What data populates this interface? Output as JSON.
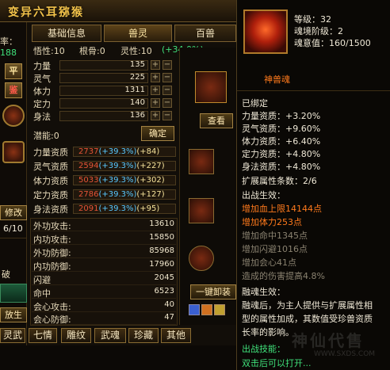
{
  "window": {
    "title": "变异六耳猕猴"
  },
  "left_strip": {
    "frag_top": "率：",
    "frag_green": "188",
    "btn_ping": "平",
    "btn_jian": "鉴",
    "btn_xiugai": "修改",
    "count": "6/10",
    "frag_po": "破",
    "btn_fangsheng": "放生"
  },
  "tabs": [
    {
      "label": "基础信息"
    },
    {
      "label": "兽灵"
    },
    {
      "label": "百兽"
    }
  ],
  "stats_header": {
    "wuxing": "悟性:10",
    "gengu": "根骨:0",
    "lingxing": "灵性:10",
    "lingxing_bonus": "(+34.0%)"
  },
  "base_attrs": [
    {
      "label": "力量",
      "value": "135"
    },
    {
      "label": "灵气",
      "value": "225"
    },
    {
      "label": "体力",
      "value": "1311"
    },
    {
      "label": "定力",
      "value": "140"
    },
    {
      "label": "身法",
      "value": "136"
    }
  ],
  "potential": {
    "label": "潜能:0",
    "confirm": "确定"
  },
  "aptitudes": [
    {
      "label": "力量资质",
      "base": "2737",
      "pct": "(+39.3%)",
      "add": "(+84)"
    },
    {
      "label": "灵气资质",
      "base": "2594",
      "pct": "(+39.3%)",
      "add": "(+227)"
    },
    {
      "label": "体力资质",
      "base": "5033",
      "pct": "(+39.3%)",
      "add": "(+302)"
    },
    {
      "label": "定力资质",
      "base": "2786",
      "pct": "(+39.3%)",
      "add": "(+127)"
    },
    {
      "label": "身法资质",
      "base": "2091",
      "pct": "(+39.3%)",
      "add": "(+95)"
    }
  ],
  "props": [
    {
      "label": "外功攻击:",
      "value": "13610"
    },
    {
      "label": "内功攻击:",
      "value": "15850"
    },
    {
      "label": "外功防御:",
      "value": "85968"
    },
    {
      "label": "内功防御:",
      "value": "17960"
    },
    {
      "label": "闪避",
      "value": "2045"
    },
    {
      "label": "命中",
      "value": "6523"
    },
    {
      "label": "会心攻击:",
      "value": "40"
    },
    {
      "label": "会心防御:",
      "value": "47"
    }
  ],
  "mid_panel": {
    "view_button": "查看",
    "unload_button": "一键卸装"
  },
  "bottom_tabs": [
    {
      "label": "灵武"
    },
    {
      "label": "七情"
    },
    {
      "label": "雕纹"
    },
    {
      "label": "武魂"
    },
    {
      "label": "珍藏"
    },
    {
      "label": "其他"
    }
  ],
  "tooltip": {
    "level": "等级：32",
    "stage": "魂境阶级：2",
    "exp": "魂意值：160/1500",
    "name": "神兽魂",
    "bound": "已绑定",
    "attr_lines": [
      "力量资质：+3.20%",
      "灵气资质：+9.60%",
      "体力资质：+6.40%",
      "定力资质：+4.80%",
      "身法资质：+4.80%"
    ],
    "ext_count": "扩展属性条数：2/6",
    "effect_title": "出战生效：",
    "active_effects": [
      "增加血上限14144点",
      "增加体力253点"
    ],
    "inactive_effects": [
      "增加命中1345点",
      "增加闪避1016点",
      "增加会心41点",
      "造成的伤害提高4.8%"
    ],
    "fuse_title": "融魂生效：",
    "fuse_text": [
      "融魂后，为主人提供与扩展属性相",
      "型的属性加成，其数值受珍兽资质",
      "长率的影响。"
    ],
    "bottom_green": "出战技能：",
    "bottom_note": "双击后可以打开..."
  },
  "watermark": {
    "text": "神仙代售",
    "url": "WWW.SXDS.COM"
  }
}
